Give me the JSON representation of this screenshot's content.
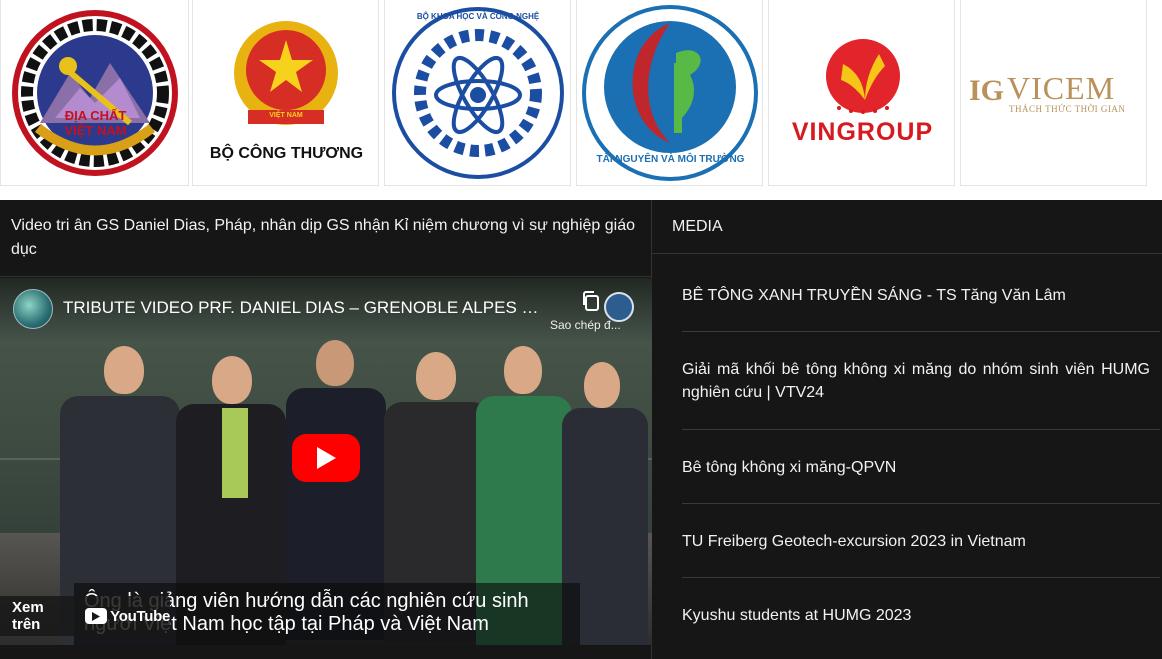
{
  "partners": {
    "logos": [
      {
        "name": "dia-chat-viet-nam",
        "text1": "ĐỊA CHẤT",
        "text2": "VIỆT NAM"
      },
      {
        "name": "bo-cong-thuong",
        "text1": "VIỆT NAM",
        "text2": "BỘ CÔNG THƯƠNG"
      },
      {
        "name": "bo-khoa-hoc-cong-nghe",
        "text1": "BỘ KHOA HỌC VÀ CÔNG NGHỆ"
      },
      {
        "name": "tai-nguyen-moi-truong",
        "text1": "TÀI NGUYÊN VÀ MÔI TRƯỜNG"
      },
      {
        "name": "vingroup",
        "text1": "VINGROUP"
      },
      {
        "name": "vicem",
        "text1": "VICEM",
        "text2": "THÁCH THỨC THỜI GIAN"
      }
    ]
  },
  "video": {
    "heading": "Video tri ân GS Daniel Dias, Pháp, nhân dịp GS nhận Kỉ niệm chương vì sự nghiệp giáo dục",
    "yt_title": "TRIBUTE VIDEO PRF. DANIEL DIAS – GRENOBLE ALPES U...",
    "copy_label": "Sao chép đ...",
    "caption_line1": "Ông là giảng viên hướng dẫn các nghiên cứu sinh",
    "caption_line2": "người Việt Nam học tập tại Pháp và Việt Nam",
    "watch_on": "Xem trên",
    "youtube": "YouTube"
  },
  "media": {
    "header": "MEDIA",
    "items": [
      "BÊ TÔNG XANH TRUYỀN SÁNG - TS Tăng Văn Lâm",
      "Giải mã khối bê tông không xi măng do nhóm sinh viên HUMG nghiên cứu | VTV24",
      "Bê tông không xi măng-QPVN",
      "TU Freiberg Geotech-excursion 2023 in Vietnam",
      "Kyushu students at HUMG 2023"
    ]
  },
  "colors": {
    "dark_bg": "#161616",
    "youtube_red": "#ff0000",
    "vingroup_red": "#d71920",
    "vicem_gold": "#b8925a"
  }
}
